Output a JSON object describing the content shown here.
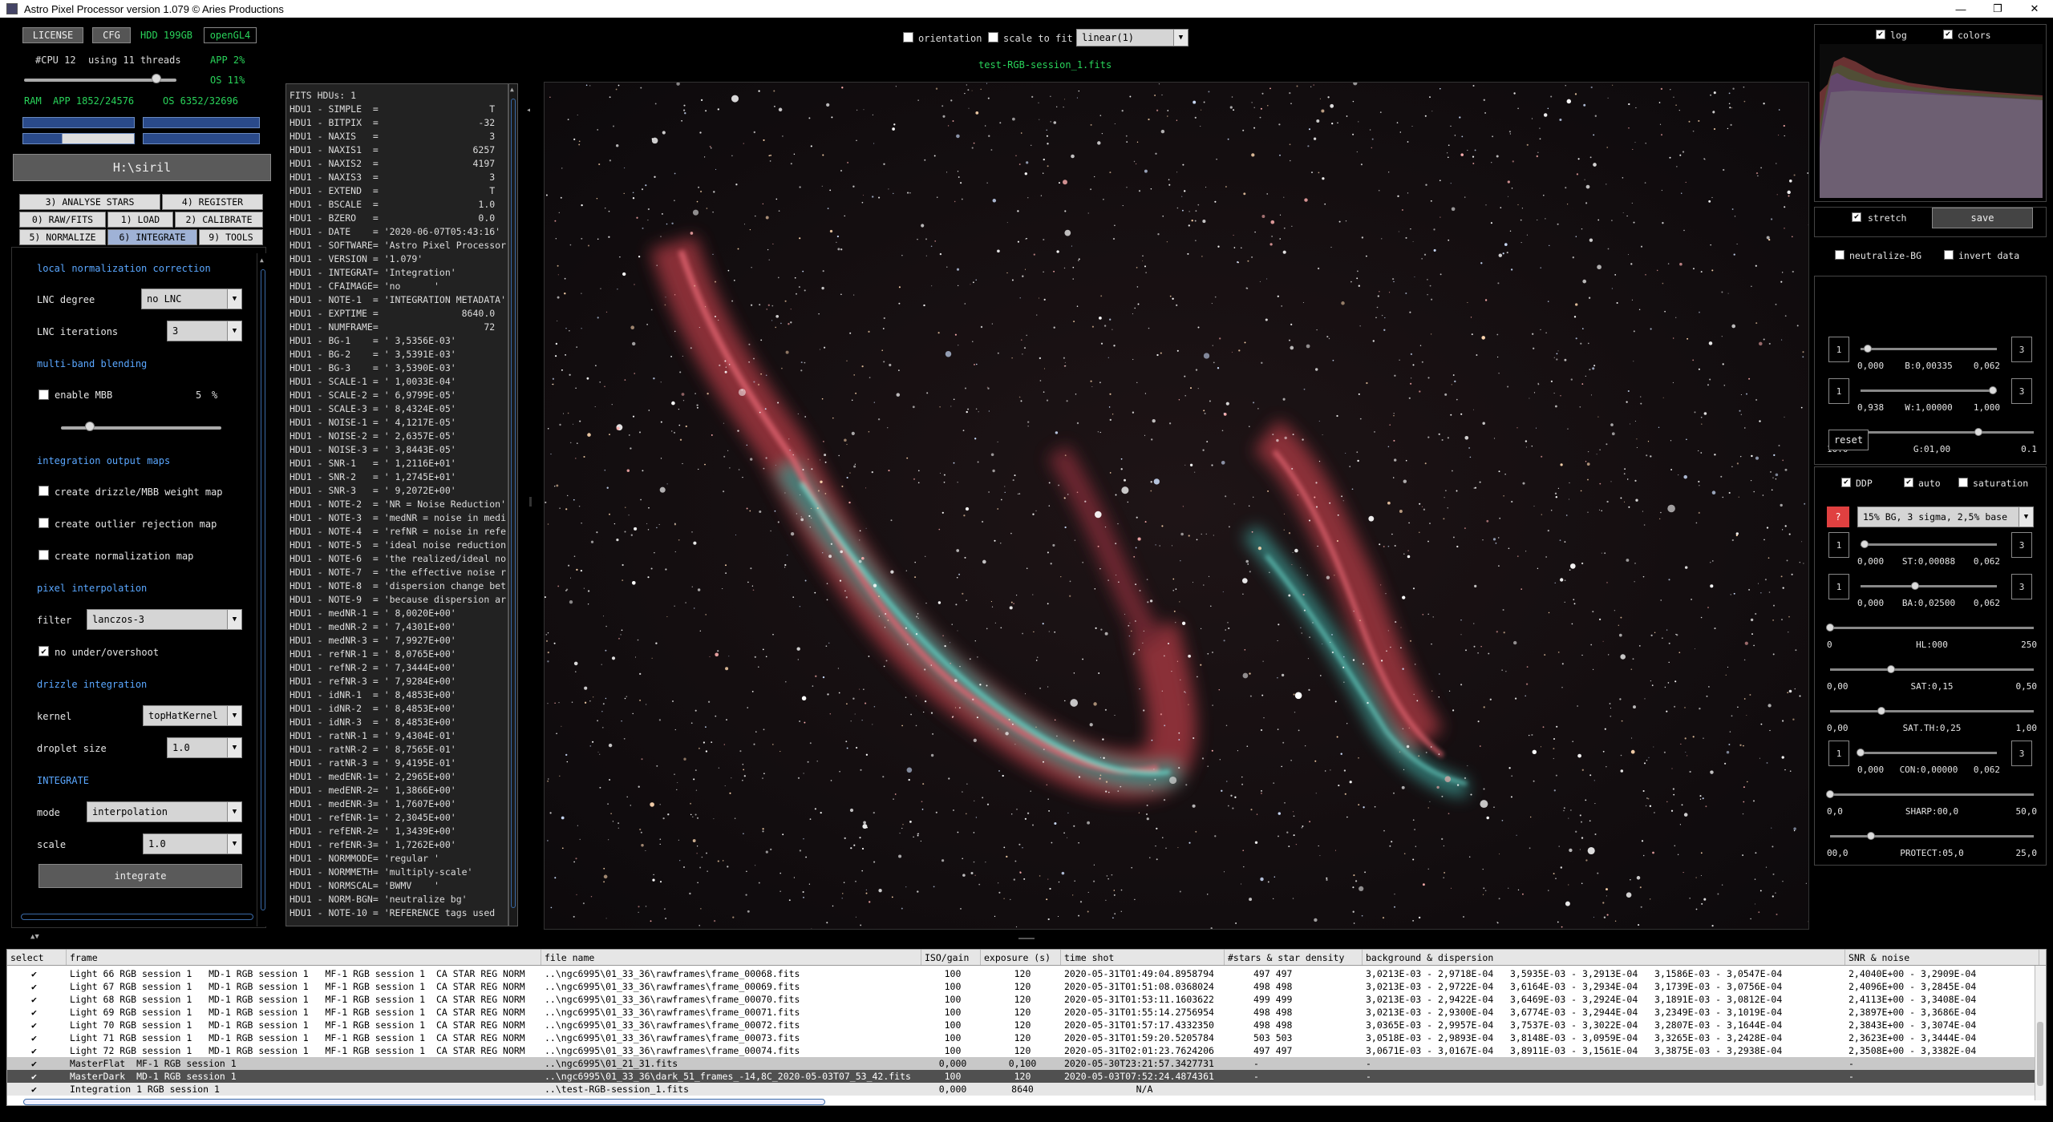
{
  "window": {
    "title": "Astro Pixel Processor version 1.079 © Aries Productions",
    "minimize": "—",
    "maximize": "❐",
    "close": "✕"
  },
  "top": {
    "license": "LICENSE",
    "cfg": "CFG",
    "hdd": "HDD 199GB",
    "opengl": "openGL4",
    "cpu": "#CPU 12",
    "threads": "using 11 threads",
    "app_cpu": "APP 2%",
    "os_cpu": "OS 11%",
    "ram": "RAM",
    "app_ram": "APP 1852/24576",
    "os_ram": "OS 6352/32696",
    "cpu_slider_level": 0.87,
    "path": "H:\\siril"
  },
  "tabs": [
    {
      "label": "3) ANALYSE STARS"
    },
    {
      "label": "4) REGISTER"
    },
    {
      "label": "0) RAW/FITS"
    },
    {
      "label": "1) LOAD"
    },
    {
      "label": "2) CALIBRATE"
    },
    {
      "label": "5) NORMALIZE"
    },
    {
      "label": "6) INTEGRATE"
    },
    {
      "label": "9) TOOLS"
    }
  ],
  "integrate_panel": {
    "lnc_title": "local normalization correction",
    "lnc_degree_label": "LNC degree",
    "lnc_degree_value": "no LNC",
    "lnc_iter_label": "LNC iterations",
    "lnc_iter_value": "3",
    "mbb_title": "multi-band blending",
    "mbb_enable": "enable MBB",
    "mbb_value": "5",
    "mbb_unit": "%",
    "mbb_level": 0.18,
    "maps_title": "integration output maps",
    "map1": "create drizzle/MBB weight map",
    "map2": "create outlier rejection map",
    "map3": "create normalization map",
    "interp_title": "pixel interpolation",
    "filter_label": "filter",
    "filter_value": "lanczos-3",
    "no_overshoot": "no under/overshoot",
    "drizzle_title": "drizzle integration",
    "kernel_label": "kernel",
    "kernel_value": "topHatKernel",
    "droplet_label": "droplet size",
    "droplet_value": "1.0",
    "integrate_title": "INTEGRATE",
    "mode_label": "mode",
    "mode_value": "interpolation",
    "scale_label": "scale",
    "scale_value": "1.0",
    "integrate_button": "integrate"
  },
  "viewer": {
    "orientation": "orientation",
    "scale_to_fit": "scale to fit",
    "stretch_mode": "linear(1)",
    "filename": "test-RGB-session_1.fits"
  },
  "fits_header": [
    "FITS HDUs: 1",
    "HDU1 - SIMPLE  =                    T",
    "HDU1 - BITPIX  =                  -32",
    "HDU1 - NAXIS   =                    3",
    "HDU1 - NAXIS1  =                 6257",
    "HDU1 - NAXIS2  =                 4197",
    "HDU1 - NAXIS3  =                    3",
    "HDU1 - EXTEND  =                    T",
    "HDU1 - BSCALE  =                  1.0",
    "HDU1 - BZERO   =                  0.0",
    "HDU1 - DATE    = '2020-06-07T05:43:16'",
    "HDU1 - SOFTWARE= 'Astro Pixel Processor",
    "HDU1 - VERSION = '1.079'",
    "HDU1 - INTEGRAT= 'Integration'",
    "HDU1 - CFAIMAGE= 'no      '",
    "HDU1 - NOTE-1  = 'INTEGRATION METADATA'",
    "HDU1 - EXPTIME =               8640.0",
    "HDU1 - NUMFRAME=                   72",
    "HDU1 - BG-1    = ' 3,5356E-03'",
    "HDU1 - BG-2    = ' 3,5391E-03'",
    "HDU1 - BG-3    = ' 3,5390E-03'",
    "HDU1 - SCALE-1 = ' 1,0033E-04'",
    "HDU1 - SCALE-2 = ' 6,9799E-05'",
    "HDU1 - SCALE-3 = ' 8,4324E-05'",
    "HDU1 - NOISE-1 = ' 4,1217E-05'",
    "HDU1 - NOISE-2 = ' 2,6357E-05'",
    "HDU1 - NOISE-3 = ' 3,8443E-05'",
    "HDU1 - SNR-1   = ' 1,2116E+01'",
    "HDU1 - SNR-2   = ' 1,2745E+01'",
    "HDU1 - SNR-3   = ' 9,2072E+00'",
    "HDU1 - NOTE-2  = 'NR = Noise Reduction'",
    "HDU1 - NOTE-3  = 'medNR = noise in medi",
    "HDU1 - NOTE-4  = 'refNR = noise in refe",
    "HDU1 - NOTE-5  = 'ideal noise reduction",
    "HDU1 - NOTE-6  = 'the realized/ideal no",
    "HDU1 - NOTE-7  = 'the effective noise r",
    "HDU1 - NOTE-8  = 'dispersion change bet",
    "HDU1 - NOTE-9  = 'because dispersion ar",
    "HDU1 - medNR-1 = ' 8,0020E+00'",
    "HDU1 - medNR-2 = ' 7,4301E+00'",
    "HDU1 - medNR-3 = ' 7,9927E+00'",
    "HDU1 - refNR-1 = ' 8,0765E+00'",
    "HDU1 - refNR-2 = ' 7,3444E+00'",
    "HDU1 - refNR-3 = ' 7,9284E+00'",
    "HDU1 - idNR-1  = ' 8,4853E+00'",
    "HDU1 - idNR-2  = ' 8,4853E+00'",
    "HDU1 - idNR-3  = ' 8,4853E+00'",
    "HDU1 - ratNR-1 = ' 9,4304E-01'",
    "HDU1 - ratNR-2 = ' 8,7565E-01'",
    "HDU1 - ratNR-3 = ' 9,4195E-01'",
    "HDU1 - medENR-1= ' 2,2965E+00'",
    "HDU1 - medENR-2= ' 1,3866E+00'",
    "HDU1 - medENR-3= ' 1,7607E+00'",
    "HDU1 - refENR-1= ' 2,3045E+00'",
    "HDU1 - refENR-2= ' 1,3439E+00'",
    "HDU1 - refENR-3= ' 1,7262E+00'",
    "HDU1 - NORMMODE= 'regular '",
    "HDU1 - NORMMETH= 'multiply-scale'",
    "HDU1 - NORMSCAL= 'BWMV    '",
    "HDU1 - NORM-BGN= 'neutralize bg'",
    "HDU1 - NOTE-10 = 'REFERENCE tags used"
  ],
  "right_panel": {
    "log": "log",
    "colors": "colors",
    "stretch": "stretch",
    "save": "save",
    "neutralize_bg": "neutralize-BG",
    "invert_data": "invert data",
    "b_min": "0,000",
    "b_val": "B:0,00335",
    "b_max": "0,062",
    "b_level": 0.05,
    "w_min": "0,938",
    "w_val": "W:1,00000",
    "w_max": "1,000",
    "w_level": 0.97,
    "reset": "reset",
    "g_min": "10.0",
    "g_val": "G:01,00",
    "g_max": "0.1",
    "g_level": 0.73,
    "ddp": "DDP",
    "auto": "auto",
    "saturation": "saturation",
    "q_button": "?",
    "preset": "15% BG, 3 sigma, 2,5% base",
    "st_min": "0,000",
    "st_val": "ST:0,00088",
    "st_max": "0,062",
    "st_level": 0.03,
    "ba_min": "0,000",
    "ba_val": "BA:0,02500",
    "ba_max": "0,062",
    "ba_level": 0.4,
    "hl_min": "0",
    "hl_val": "HL:000",
    "hl_max": "250",
    "hl_level": 0.0,
    "sat_min": "0,00",
    "sat_val": "SAT:0,15",
    "sat_max": "0,50",
    "sat_level": 0.3,
    "satth_min": "0,00",
    "satth_val": "SAT.TH:0,25",
    "satth_max": "1,00",
    "satth_level": 0.25,
    "con_min": "0,000",
    "con_val": "CON:0,00000",
    "con_max": "0,062",
    "con_level": 0.0,
    "sharp_min": "0,0",
    "sharp_val": "SHARP:00,0",
    "sharp_max": "50,0",
    "sharp_level": 0.0,
    "prot_min": "00,0",
    "prot_val": "PROTECT:05,0",
    "prot_max": "25,0",
    "prot_level": 0.2,
    "one": "1",
    "three": "3"
  },
  "table": {
    "headers": [
      "select",
      "frame",
      "file name",
      "ISO/gain",
      "exposure (s)",
      "time shot",
      "#stars & star density",
      "background & dispersion",
      "SNR & noise"
    ],
    "rows": [
      {
        "check": "✔",
        "frame": "Light 66 RGB session 1   MD-1 RGB session 1   MF-1 RGB session 1  CA STAR REG NORM",
        "file": "..\\ngc6995\\01_33_36\\rawframes\\frame_00068.fits",
        "iso": "100",
        "exp": "120",
        "time": "2020-05-31T01:49:04.8958794",
        "stars": "497 497",
        "bg": "3,0213E-03 - 2,9718E-04   3,5935E-03 - 3,2913E-04   3,1586E-03 - 3,0547E-04",
        "snr": "2,4040E+00 - 3,2909E-04",
        "style": ""
      },
      {
        "check": "✔",
        "frame": "Light 67 RGB session 1   MD-1 RGB session 1   MF-1 RGB session 1  CA STAR REG NORM",
        "file": "..\\ngc6995\\01_33_36\\rawframes\\frame_00069.fits",
        "iso": "100",
        "exp": "120",
        "time": "2020-05-31T01:51:08.0368024",
        "stars": "498 498",
        "bg": "3,0213E-03 - 2,9722E-04   3,6164E-03 - 3,2934E-04   3,1739E-03 - 3,0756E-04",
        "snr": "2,4096E+00 - 3,2845E-04",
        "style": ""
      },
      {
        "check": "✔",
        "frame": "Light 68 RGB session 1   MD-1 RGB session 1   MF-1 RGB session 1  CA STAR REG NORM",
        "file": "..\\ngc6995\\01_33_36\\rawframes\\frame_00070.fits",
        "iso": "100",
        "exp": "120",
        "time": "2020-05-31T01:53:11.1603622",
        "stars": "499 499",
        "bg": "3,0213E-03 - 2,9422E-04   3,6469E-03 - 3,2924E-04   3,1891E-03 - 3,0812E-04",
        "snr": "2,4113E+00 - 3,3408E-04",
        "style": ""
      },
      {
        "check": "✔",
        "frame": "Light 69 RGB session 1   MD-1 RGB session 1   MF-1 RGB session 1  CA STAR REG NORM",
        "file": "..\\ngc6995\\01_33_36\\rawframes\\frame_00071.fits",
        "iso": "100",
        "exp": "120",
        "time": "2020-05-31T01:55:14.2756954",
        "stars": "498 498",
        "bg": "3,0213E-03 - 2,9300E-04   3,6774E-03 - 3,2944E-04   3,2349E-03 - 3,1019E-04",
        "snr": "2,3897E+00 - 3,3686E-04",
        "style": ""
      },
      {
        "check": "✔",
        "frame": "Light 70 RGB session 1   MD-1 RGB session 1   MF-1 RGB session 1  CA STAR REG NORM",
        "file": "..\\ngc6995\\01_33_36\\rawframes\\frame_00072.fits",
        "iso": "100",
        "exp": "120",
        "time": "2020-05-31T01:57:17.4332350",
        "stars": "498 498",
        "bg": "3,0365E-03 - 2,9957E-04   3,7537E-03 - 3,3022E-04   3,2807E-03 - 3,1644E-04",
        "snr": "2,3843E+00 - 3,3074E-04",
        "style": ""
      },
      {
        "check": "✔",
        "frame": "Light 71 RGB session 1   MD-1 RGB session 1   MF-1 RGB session 1  CA STAR REG NORM",
        "file": "..\\ngc6995\\01_33_36\\rawframes\\frame_00073.fits",
        "iso": "100",
        "exp": "120",
        "time": "2020-05-31T01:59:20.5205784",
        "stars": "503 503",
        "bg": "3,0518E-03 - 2,9893E-04   3,8148E-03 - 3,0959E-04   3,3265E-03 - 3,2428E-04",
        "snr": "2,3623E+00 - 3,3444E-04",
        "style": ""
      },
      {
        "check": "✔",
        "frame": "Light 72 RGB session 1   MD-1 RGB session 1   MF-1 RGB session 1  CA STAR REG NORM",
        "file": "..\\ngc6995\\01_33_36\\rawframes\\frame_00074.fits",
        "iso": "100",
        "exp": "120",
        "time": "2020-05-31T02:01:23.7624206",
        "stars": "497 497",
        "bg": "3,0671E-03 - 3,0167E-04   3,8911E-03 - 3,1561E-04   3,3875E-03 - 3,2938E-04",
        "snr": "2,3508E+00 - 3,3382E-04",
        "style": ""
      },
      {
        "check": "✔",
        "frame": "MasterFlat  MF-1 RGB session 1",
        "file": "..\\ngc6995\\01_21_31.fits",
        "iso": "0,000",
        "exp": "0,100",
        "time": "2020-05-30T23:21:57.3427731",
        "stars": "-",
        "bg": "-",
        "snr": "-",
        "style": "flat"
      },
      {
        "check": "✔",
        "frame": "MasterDark  MD-1 RGB session 1",
        "file": "..\\ngc6995\\01_33_36\\dark_51_frames_-14,8C_2020-05-03T07_53_42.fits",
        "iso": "100",
        "exp": "120",
        "time": "2020-05-03T07:52:24.4874361",
        "stars": "-",
        "bg": "-",
        "snr": "-",
        "style": "dark"
      },
      {
        "check": "✔",
        "frame": "Integration 1 RGB session 1",
        "file": "..\\test-RGB-session_1.fits",
        "iso": "0,000",
        "exp": "8640",
        "time": "N/A",
        "stars": "",
        "bg": "",
        "snr": "",
        "style": "integ"
      }
    ]
  },
  "colors": {
    "accent_blue": "#5aa7ff",
    "green_text": "#29d35a",
    "bg": "#000000"
  }
}
